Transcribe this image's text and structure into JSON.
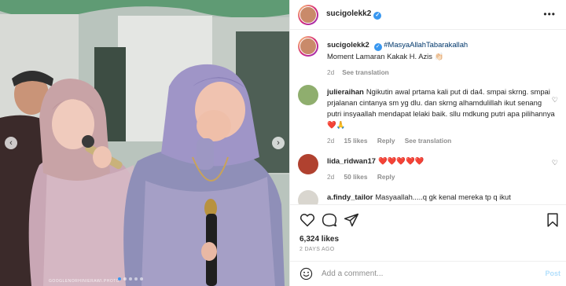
{
  "post": {
    "username": "sucigolekk2",
    "media_watermark": "GOOGLENORHINIERAWI.PHOTO",
    "likes": "6,324 likes",
    "date": "2 DAYS AGO"
  },
  "caption": {
    "username": "sucigolekk2",
    "hashtag": "#MasyaAllahTabarakallah",
    "text": "Moment Lamaran Kakak H. Azis 👏🏻",
    "time": "2d",
    "see_translation": "See translation"
  },
  "comments": [
    {
      "username": "julieraihan",
      "text": "Ngikutin awal prtama kali put di da4. smpai skrng. smpai prjalanan cintanya sm yg dlu. dan skrng alhamdulillah ikut senang putri insyaallah mendapat lelaki baik. sllu mdkung putri apa pilihannya ❤️🙏",
      "time": "2d",
      "likes": "15 likes",
      "reply": "Reply",
      "see_translation": "See translation"
    },
    {
      "username": "lida_ridwan17",
      "text": "❤️❤️❤️❤️❤️",
      "time": "2d",
      "likes": "50 likes",
      "reply": "Reply"
    },
    {
      "username": "a.findy_tailor",
      "text": "Masyaallah.....q gk kenal mereka tp q ikut"
    }
  ],
  "composer": {
    "placeholder": "Add a comment...",
    "post_label": "Post"
  },
  "icons": {
    "more": "more-options-icon",
    "like": "heart-icon",
    "comment": "comment-icon",
    "share": "share-icon",
    "save": "bookmark-icon",
    "emoji": "emoji-icon",
    "verified": "verified-badge-icon"
  },
  "colors": {
    "accent": "#3897f0",
    "link": "#00376b",
    "muted": "#8e8e8e",
    "post_disabled": "#b2dffc"
  }
}
